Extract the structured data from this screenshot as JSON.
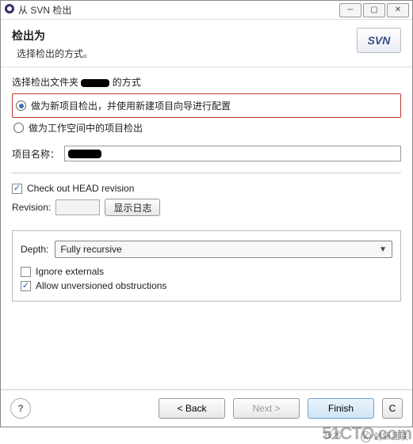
{
  "window": {
    "title": "从 SVN 检出"
  },
  "banner": {
    "title": "检出为",
    "subtitle": "选择检出的方式。",
    "logo": "SVN"
  },
  "method": {
    "label_prefix": "选择检出文件夹",
    "label_suffix": "的方式",
    "option_new_project": "做为新项目检出，并使用新建项目向导进行配置",
    "option_workspace": "做为工作空间中的项目检出"
  },
  "project": {
    "label": "项目名称："
  },
  "revision": {
    "head_label": "Check out HEAD revision",
    "label": "Revision:",
    "show_log_btn": "显示日志"
  },
  "depth": {
    "label": "Depth:",
    "value": "Fully recursive",
    "ignore_externals": "Ignore externals",
    "allow_unversioned": "Allow unversioned obstructions"
  },
  "footer": {
    "back": "< Back",
    "next": "Next >",
    "finish": "Finish",
    "cancel": "C"
  },
  "watermark": {
    "main": "51CTO.com",
    "sub": "技术",
    "brand": "创新互联"
  }
}
